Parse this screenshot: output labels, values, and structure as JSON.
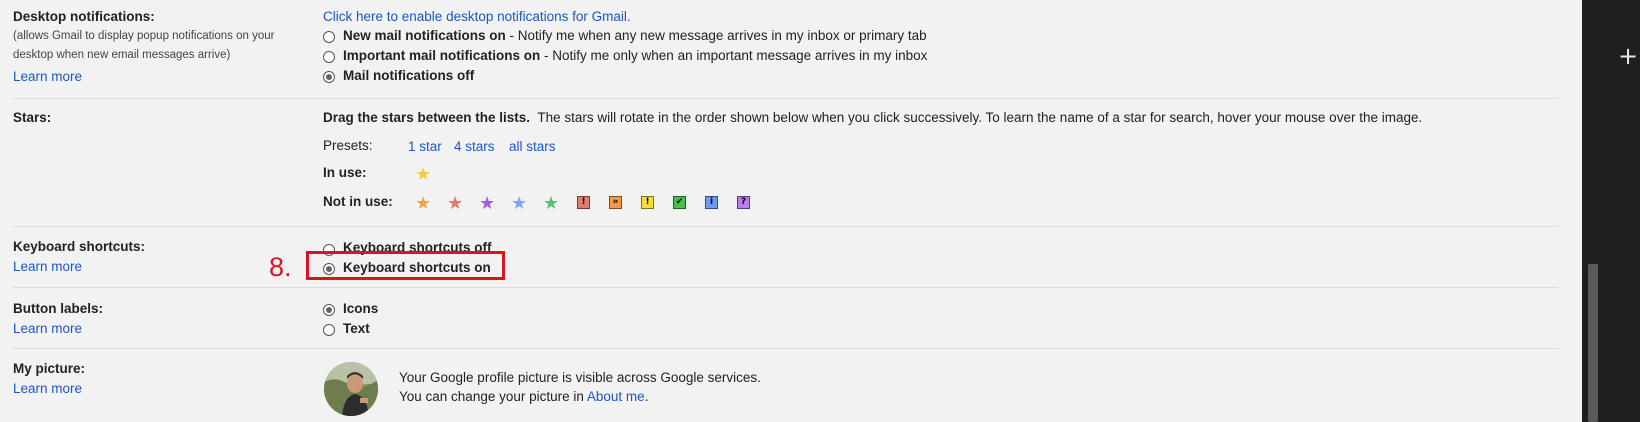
{
  "desktop_notifications": {
    "label": "Desktop notifications:",
    "description_line1": "(allows Gmail to display popup notifications on your",
    "description_line2": "desktop when new email messages arrive)",
    "learn_more": "Learn more",
    "enable_link": "Click here to enable desktop notifications for Gmail.",
    "options": [
      {
        "title": "New mail notifications on",
        "desc": " - Notify me when any new message arrives in my inbox or primary tab",
        "selected": false
      },
      {
        "title": "Important mail notifications on",
        "desc": " - Notify me only when an important message arrives in my inbox",
        "selected": false
      },
      {
        "title": "Mail notifications off",
        "desc": "",
        "selected": true
      }
    ]
  },
  "stars": {
    "label": "Stars:",
    "instructions_bold": "Drag the stars between the lists.",
    "instructions": "  The stars will rotate in the order shown below when you click successively. To learn the name of a star for search, hover your mouse over the image.",
    "presets_label": "Presets:",
    "presets": [
      "1 star",
      "4 stars",
      "all stars"
    ],
    "in_use_label": "In use:",
    "not_in_use_label": "Not in use:",
    "in_use": [
      {
        "icon": "yellow-star-icon",
        "color": "#f2c94c"
      }
    ],
    "not_in_use": [
      {
        "icon": "orange-star-icon",
        "color": "#f0a04b"
      },
      {
        "icon": "red-star-icon",
        "color": "#e07b67"
      },
      {
        "icon": "purple-star-icon",
        "color": "#a25ddc"
      },
      {
        "icon": "blue-star-icon",
        "color": "#7ea6f4"
      },
      {
        "icon": "green-star-icon",
        "color": "#5dbb7a"
      },
      {
        "icon": "red-bang-icon",
        "color": "#e27c6e",
        "glyph": "!"
      },
      {
        "icon": "orange-guillemet-icon",
        "color": "#f09a4a",
        "glyph": "»"
      },
      {
        "icon": "yellow-bang-icon",
        "color": "#f6dd3b",
        "glyph": "!"
      },
      {
        "icon": "green-check-icon",
        "color": "#43c14b",
        "glyph": "✔"
      },
      {
        "icon": "blue-info-icon",
        "color": "#6d9af2",
        "glyph": "i"
      },
      {
        "icon": "purple-question-icon",
        "color": "#b67cf0",
        "glyph": "?"
      }
    ]
  },
  "keyboard_shortcuts": {
    "label": "Keyboard shortcuts:",
    "learn_more": "Learn more",
    "options": [
      {
        "title": "Keyboard shortcuts off",
        "selected": false
      },
      {
        "title": "Keyboard shortcuts on",
        "selected": true
      }
    ],
    "annotation": "8."
  },
  "button_labels": {
    "label": "Button labels:",
    "learn_more": "Learn more",
    "options": [
      {
        "title": "Icons",
        "selected": true
      },
      {
        "title": "Text",
        "selected": false
      }
    ]
  },
  "my_picture": {
    "label": "My picture:",
    "learn_more": "Learn more",
    "line1": "Your Google profile picture is visible across Google services.",
    "line2_prefix": "You can change your picture in ",
    "line2_link": "About me",
    "line2_suffix": "."
  },
  "side_panel": {
    "plus_icon": "+"
  }
}
